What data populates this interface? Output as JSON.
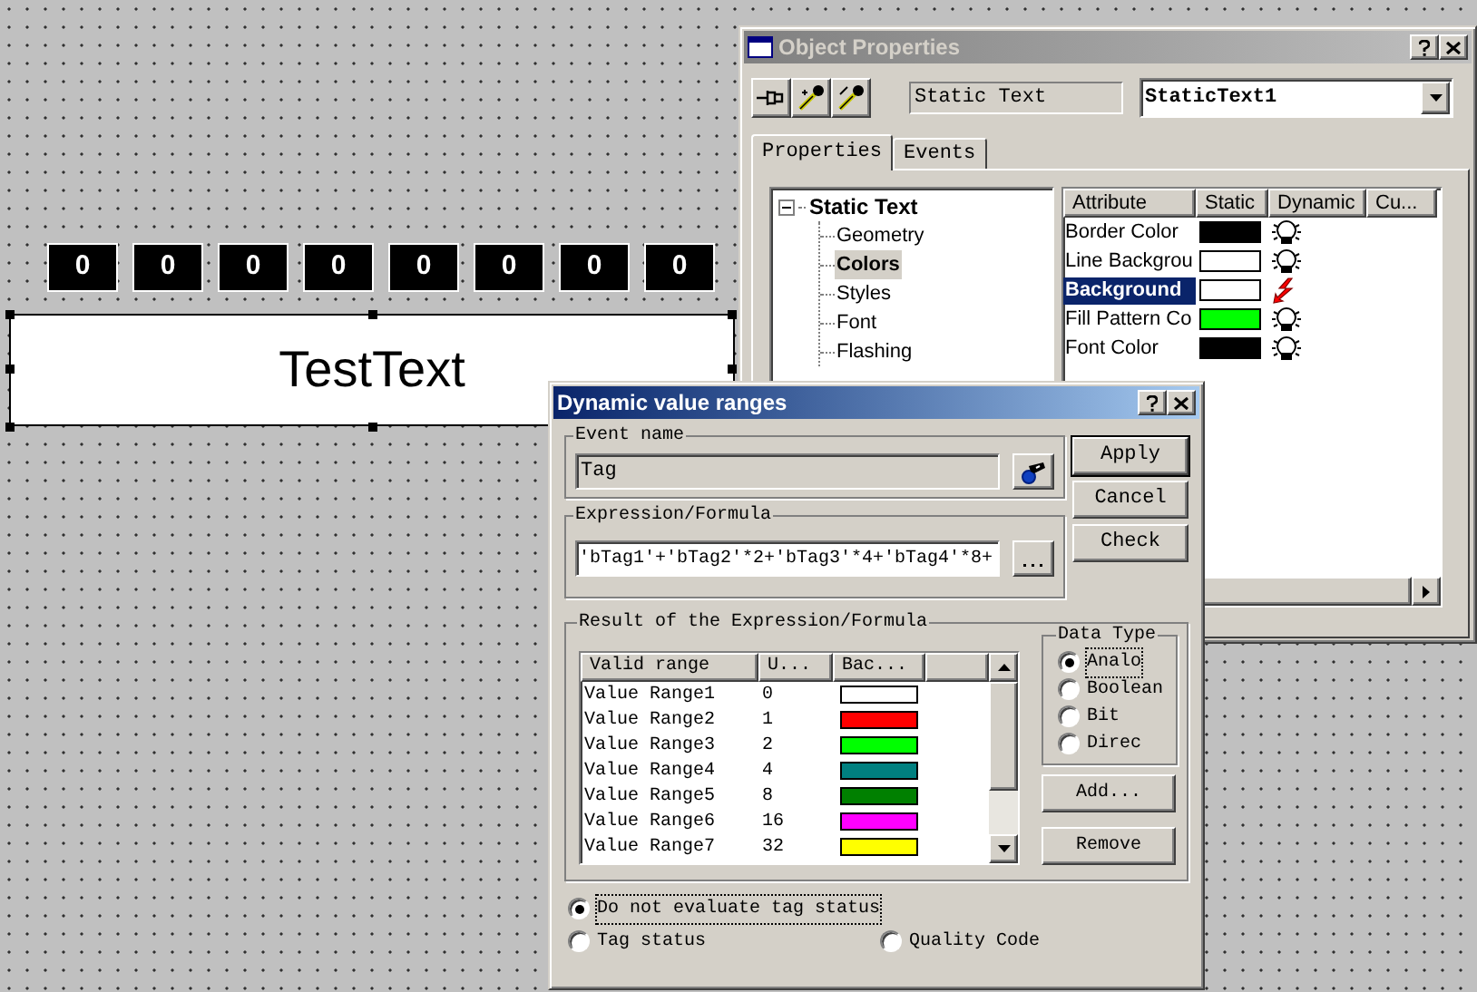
{
  "canvas": {
    "digit_displays": [
      "0",
      "0",
      "0",
      "0",
      "0",
      "0",
      "0",
      "0"
    ],
    "text_object": {
      "text": "TestText",
      "selected": true
    }
  },
  "object_properties": {
    "title": "Object Properties",
    "active": false,
    "object_type": "Static Text",
    "object_name": "StaticText1",
    "tabs": [
      {
        "label": "Properties",
        "selected": true
      },
      {
        "label": "Events",
        "selected": false
      }
    ],
    "tree": {
      "label": "Static Text",
      "expanded": true,
      "children": [
        {
          "label": "Geometry",
          "selected": false
        },
        {
          "label": "Colors",
          "selected": true
        },
        {
          "label": "Styles",
          "selected": false
        },
        {
          "label": "Font",
          "selected": false
        },
        {
          "label": "Flashing",
          "selected": false
        }
      ]
    },
    "attributes": {
      "columns": [
        "Attribute",
        "Static",
        "Dynamic",
        "Cu..."
      ],
      "rows": [
        {
          "attribute": "Border Color",
          "selected": false,
          "color": "#000000",
          "dynamic": false
        },
        {
          "attribute": "Line Backgrou",
          "selected": false,
          "color": "#ffffff",
          "dynamic": false
        },
        {
          "attribute": "Background",
          "selected": true,
          "color": "#ffffff",
          "dynamic": true
        },
        {
          "attribute": "Fill Pattern Co",
          "selected": false,
          "color": "#00ff00",
          "dynamic": false
        },
        {
          "attribute": "Font Color",
          "selected": false,
          "color": "#000000",
          "dynamic": false
        }
      ]
    }
  },
  "dynamic_value_ranges": {
    "title": "Dynamic value ranges",
    "active": true,
    "event_name": {
      "legend": "Event name",
      "value": "Tag"
    },
    "expression": {
      "legend": "Expression/Formula",
      "value": "'bTag1'+'bTag2'*2+'bTag3'*4+'bTag4'*8+"
    },
    "buttons": [
      {
        "label": "Apply",
        "default": true
      },
      {
        "label": "Cancel",
        "default": false
      },
      {
        "label": "Check",
        "default": false
      }
    ],
    "result": {
      "legend": "Result of the Expression/Formula",
      "columns": [
        "Valid range",
        "U...",
        "Bac..."
      ],
      "rows": [
        {
          "name": "Value Range1",
          "value": "0",
          "color": "#ffffff"
        },
        {
          "name": "Value Range2",
          "value": "1",
          "color": "#ff0000"
        },
        {
          "name": "Value Range3",
          "value": "2",
          "color": "#00ff00"
        },
        {
          "name": "Value Range4",
          "value": "4",
          "color": "#008080"
        },
        {
          "name": "Value Range5",
          "value": "8",
          "color": "#008000"
        },
        {
          "name": "Value Range6",
          "value": "16",
          "color": "#ff00ff"
        },
        {
          "name": "Value Range7",
          "value": "32",
          "color": "#ffff00"
        }
      ]
    },
    "data_type": {
      "legend": "Data Type",
      "options": [
        {
          "label": "Analo",
          "selected": true
        },
        {
          "label": "Boolean",
          "selected": false
        },
        {
          "label": "Bit",
          "selected": false
        },
        {
          "label": "Direc",
          "selected": false
        }
      ]
    },
    "list_buttons": [
      "Add...",
      "Remove"
    ],
    "tag_status": [
      {
        "label": "Do not evaluate tag status",
        "selected": true
      },
      {
        "label": "Tag status",
        "selected": false
      },
      {
        "label": "Quality Code",
        "selected": false
      }
    ]
  }
}
